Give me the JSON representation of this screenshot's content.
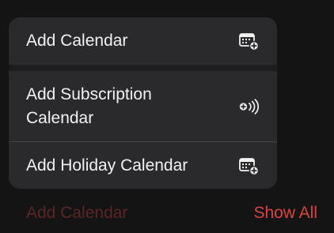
{
  "menu": {
    "items": [
      {
        "label": "Add Calendar",
        "icon": "calendar-add-icon"
      },
      {
        "label": "Add Subscription\nCalendar",
        "icon": "subscription-broadcast-icon"
      },
      {
        "label": "Add Holiday Calendar",
        "icon": "calendar-add-icon"
      }
    ]
  },
  "bottom": {
    "left_label": "Add Calendar",
    "right_label": "Show All",
    "accent_color": "#d9443b"
  }
}
